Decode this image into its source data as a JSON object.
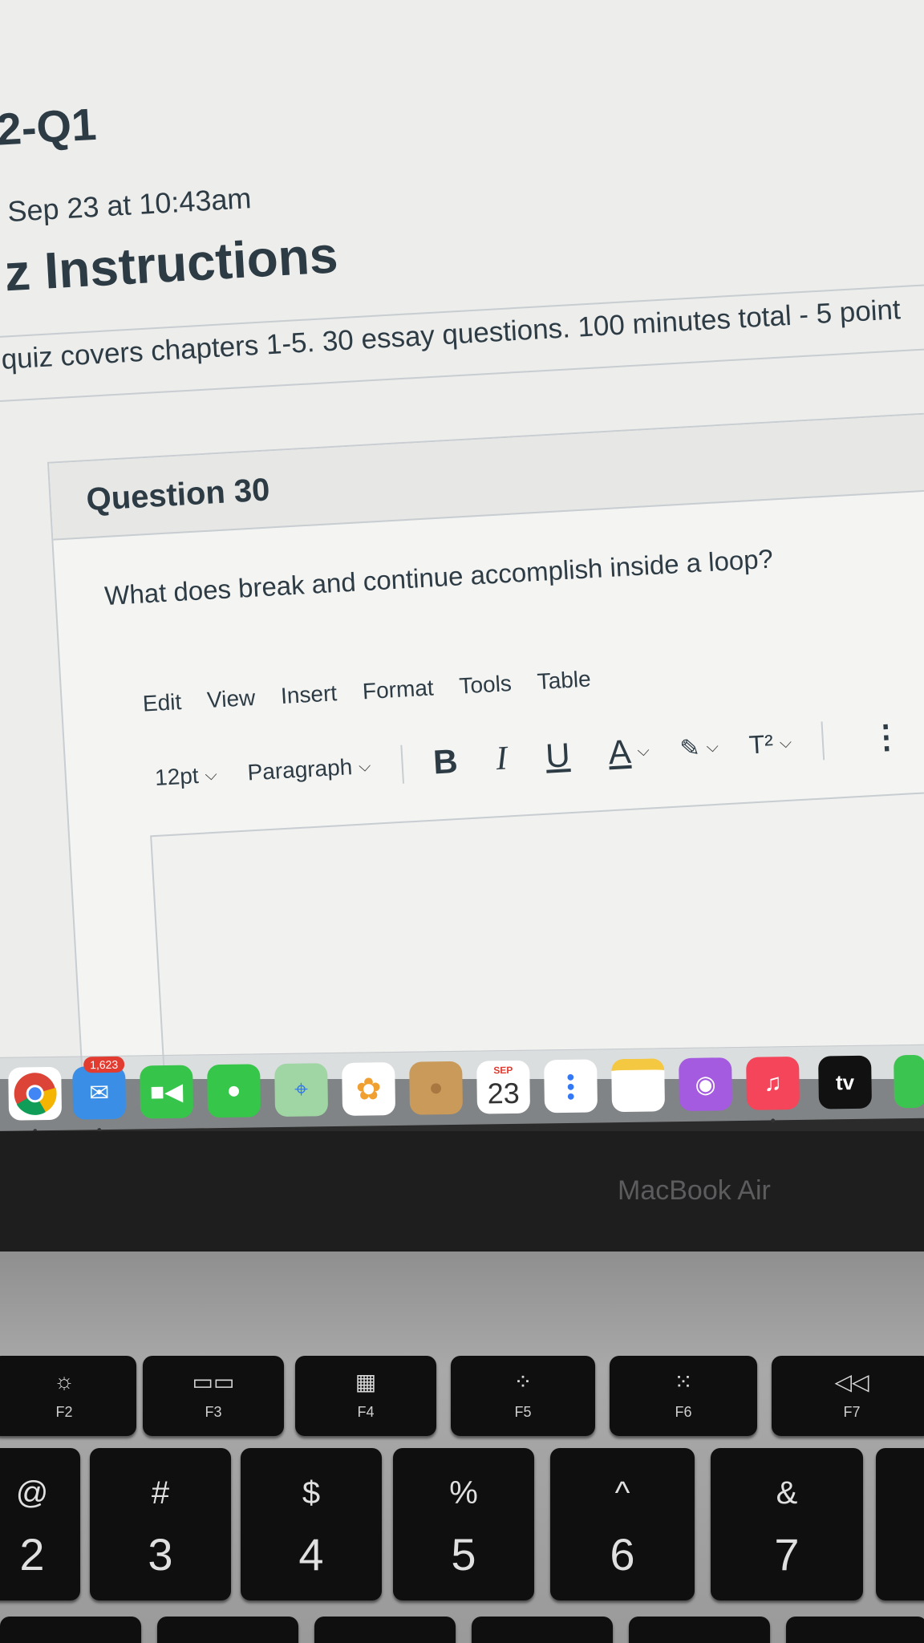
{
  "quiz": {
    "code": "2-Q1",
    "date_line": "Sep 23 at 10:43am",
    "heading": "z Instructions",
    "description": "quiz covers chapters 1-5. 30 essay questions.  100 minutes total - 5 point"
  },
  "question": {
    "title": "Question 30",
    "text": "What does break and continue accomplish inside a loop?"
  },
  "editor": {
    "menu": [
      "Edit",
      "View",
      "Insert",
      "Format",
      "Tools",
      "Table"
    ],
    "font_size": "12pt",
    "block_format": "Paragraph",
    "bold": "B",
    "italic": "I",
    "underline": "U",
    "text_color": "A",
    "superscript": "T²",
    "more": "⋮"
  },
  "dock": {
    "mail_badge": "1,623",
    "calendar_month": "SEP",
    "calendar_day": "23",
    "tv_label": "tv",
    "icons": [
      "chrome-icon",
      "mail-icon",
      "facetime-icon",
      "messages-icon",
      "maps-icon",
      "photos-icon",
      "contacts-icon",
      "calendar-icon",
      "reminders-icon",
      "notes-icon",
      "podcasts-icon",
      "music-icon",
      "apple-tv-icon"
    ]
  },
  "laptop": {
    "brand": "MacBook Air"
  },
  "keyboard": {
    "fn_keys": [
      {
        "label": "F2",
        "glyph": "☼"
      },
      {
        "label": "F3",
        "glyph": "▭▭"
      },
      {
        "label": "F4",
        "glyph": "▦"
      },
      {
        "label": "F5",
        "glyph": "⁘"
      },
      {
        "label": "F6",
        "glyph": "⁙"
      },
      {
        "label": "F7",
        "glyph": "◁◁"
      }
    ],
    "number_keys": [
      {
        "top": "@",
        "bottom": "2"
      },
      {
        "top": "#",
        "bottom": "3"
      },
      {
        "top": "$",
        "bottom": "4"
      },
      {
        "top": "%",
        "bottom": "5"
      },
      {
        "top": "^",
        "bottom": "6"
      },
      {
        "top": "&",
        "bottom": "7"
      }
    ]
  }
}
